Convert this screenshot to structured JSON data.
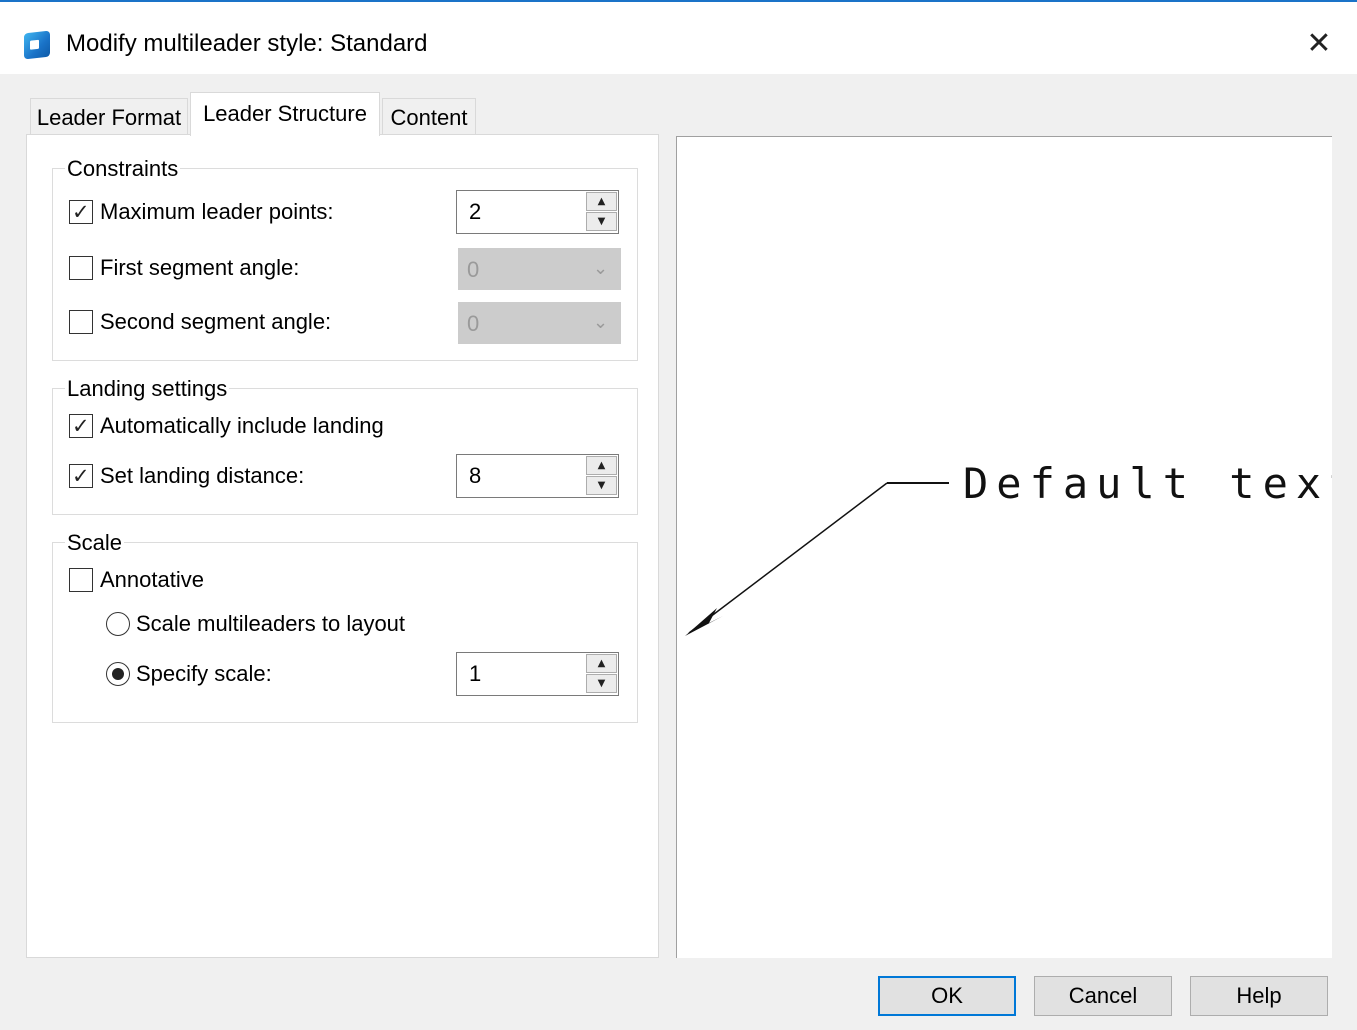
{
  "window": {
    "title": "Modify multileader style: Standard"
  },
  "tabs": [
    {
      "label": "Leader Format",
      "active": false
    },
    {
      "label": "Leader Structure",
      "active": true
    },
    {
      "label": "Content",
      "active": false
    }
  ],
  "constraints": {
    "legend": "Constraints",
    "max_leader_points": {
      "label": "Maximum leader points:",
      "checked": true,
      "value": "2"
    },
    "first_segment_angle": {
      "label": "First segment angle:",
      "checked": false,
      "value": "0"
    },
    "second_segment_angle": {
      "label": "Second segment angle:",
      "checked": false,
      "value": "0"
    }
  },
  "landing": {
    "legend": "Landing settings",
    "auto_include_landing": {
      "label": "Automatically include landing",
      "checked": true
    },
    "set_landing_distance": {
      "label": "Set landing distance:",
      "checked": true,
      "value": "8"
    }
  },
  "scale": {
    "legend": "Scale",
    "annotative": {
      "label": "Annotative",
      "checked": false
    },
    "scale_to_layout": {
      "label": "Scale multileaders to layout",
      "selected": false
    },
    "specify_scale": {
      "label": "Specify scale:",
      "selected": true,
      "value": "1"
    }
  },
  "preview": {
    "text": "Default text"
  },
  "buttons": {
    "ok": "OK",
    "cancel": "Cancel",
    "help": "Help"
  },
  "icons": {
    "app": "app-icon",
    "close": "close-icon",
    "spin_up": "spin-up-icon",
    "spin_down": "spin-down-icon",
    "dropdown": "chevron-down-icon"
  },
  "colors": {
    "accent": "#0078d7",
    "title_border": "#1a73c8"
  }
}
